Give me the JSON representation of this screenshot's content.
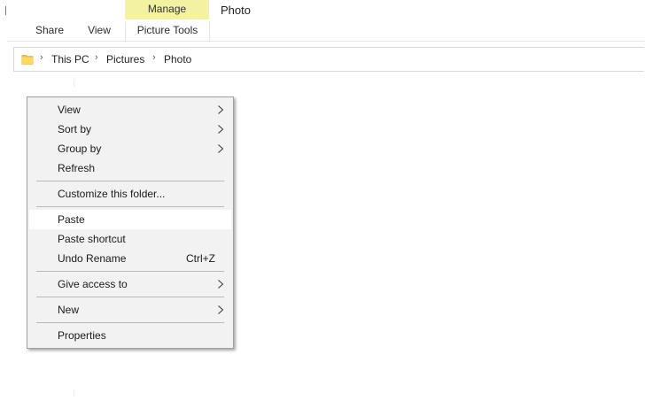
{
  "ribbon": {
    "contextual_header": "Manage",
    "window_title": "Photo",
    "tabs": [
      {
        "label": "Share"
      },
      {
        "label": "View"
      },
      {
        "label": "Picture Tools"
      }
    ]
  },
  "address_bar": {
    "icon": "folder-icon",
    "breadcrumbs": [
      {
        "label": "This PC"
      },
      {
        "label": "Pictures"
      },
      {
        "label": "Photo"
      }
    ]
  },
  "context_menu": {
    "items": [
      {
        "label": "View",
        "submenu": true
      },
      {
        "label": "Sort by",
        "submenu": true
      },
      {
        "label": "Group by",
        "submenu": true
      },
      {
        "label": "Refresh"
      },
      {
        "label": "Customize this folder..."
      },
      {
        "label": "Paste",
        "highlighted": true
      },
      {
        "label": "Paste shortcut"
      },
      {
        "label": "Undo Rename",
        "shortcut": "Ctrl+Z"
      },
      {
        "label": "Give access to",
        "submenu": true
      },
      {
        "label": "New",
        "submenu": true
      },
      {
        "label": "Properties"
      }
    ]
  },
  "colors": {
    "contextual_tab_bg": "#f2f2a0",
    "menu_bg": "#f2f2f2",
    "menu_hover_bg": "#ffffff",
    "folder_icon": "#f5c842"
  }
}
